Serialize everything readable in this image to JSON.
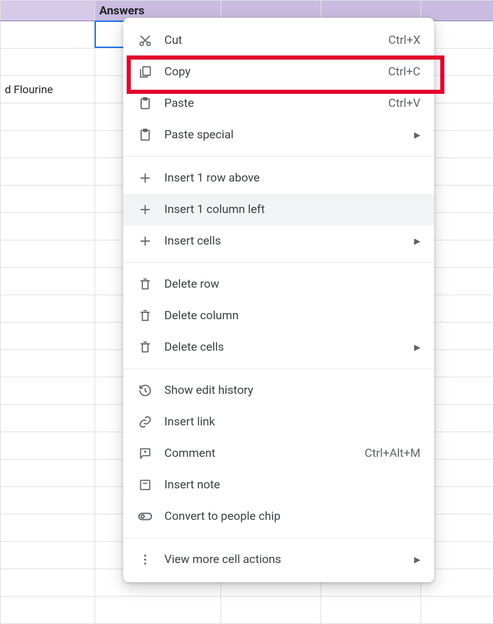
{
  "sheet": {
    "header_label": "Answers",
    "row3_cell_a": "d Flourine"
  },
  "menu": {
    "items": [
      {
        "label": "Cut",
        "shortcut": "Ctrl+X"
      },
      {
        "label": "Copy",
        "shortcut": "Ctrl+C"
      },
      {
        "label": "Paste",
        "shortcut": "Ctrl+V"
      },
      {
        "label": "Paste special",
        "submenu": true
      },
      {
        "label": "Insert 1 row above"
      },
      {
        "label": "Insert 1 column left",
        "hover": true
      },
      {
        "label": "Insert cells",
        "submenu": true
      },
      {
        "label": "Delete row"
      },
      {
        "label": "Delete column"
      },
      {
        "label": "Delete cells",
        "submenu": true
      },
      {
        "label": "Show edit history"
      },
      {
        "label": "Insert link"
      },
      {
        "label": "Comment",
        "shortcut": "Ctrl+Alt+M"
      },
      {
        "label": "Insert note"
      },
      {
        "label": "Convert to people chip"
      },
      {
        "label": "View more cell actions",
        "submenu": true
      }
    ]
  }
}
